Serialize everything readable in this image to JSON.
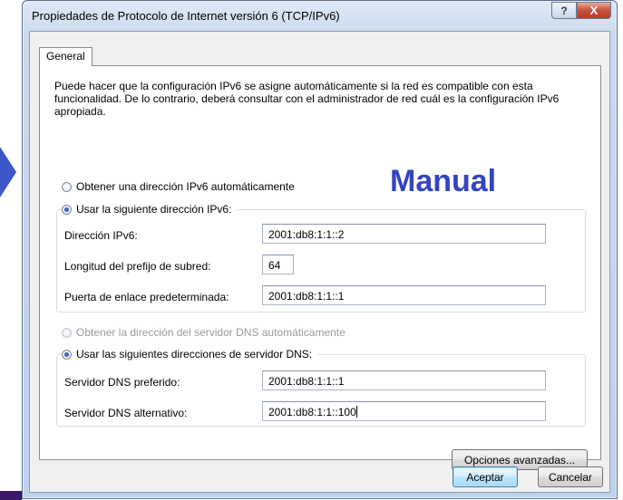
{
  "window": {
    "title": "Propiedades de Protocolo de Internet versión 6 (TCP/IPv6)",
    "help_glyph": "?",
    "close_glyph": "X"
  },
  "tabs": [
    {
      "label": "General"
    }
  ],
  "description": "Puede hacer que la configuración IPv6 se asigne automáticamente si la red es compatible con esta funcionalidad. De lo contrario, deberá consultar con el administrador de red cuál es la configuración IPv6 apropiada.",
  "annotation": "Manual",
  "ip": {
    "auto_label": "Obtener una dirección IPv6 automáticamente",
    "auto_selected": false,
    "manual_label": "Usar la siguiente dirección IPv6:",
    "manual_selected": true,
    "fields": {
      "address_label": "Dirección IPv6:",
      "address_value": "2001:db8:1:1::2",
      "prefix_label": "Longitud del prefijo de subred:",
      "prefix_value": "64",
      "gateway_label": "Puerta de enlace predeterminada:",
      "gateway_value": "2001:db8:1:1::1"
    }
  },
  "dns": {
    "auto_label": "Obtener la dirección del servidor DNS automáticamente",
    "auto_enabled": false,
    "manual_label": "Usar las siguientes direcciones de servidor DNS:",
    "manual_selected": true,
    "fields": {
      "preferred_label": "Servidor DNS preferido:",
      "preferred_value": "2001:db8:1:1::1",
      "alternate_label": "Servidor DNS alternativo:",
      "alternate_value": "2001:db8:1:1::100"
    }
  },
  "buttons": {
    "advanced": "Opciones avanzadas...",
    "ok": "Aceptar",
    "cancel": "Cancelar"
  },
  "colors": {
    "annotation": "#3344c2",
    "slide_arrow": "#3b56c9",
    "close_button": "#c7503b"
  },
  "icons": [
    "help-icon",
    "close-icon",
    "slide-arrow-icon"
  ]
}
